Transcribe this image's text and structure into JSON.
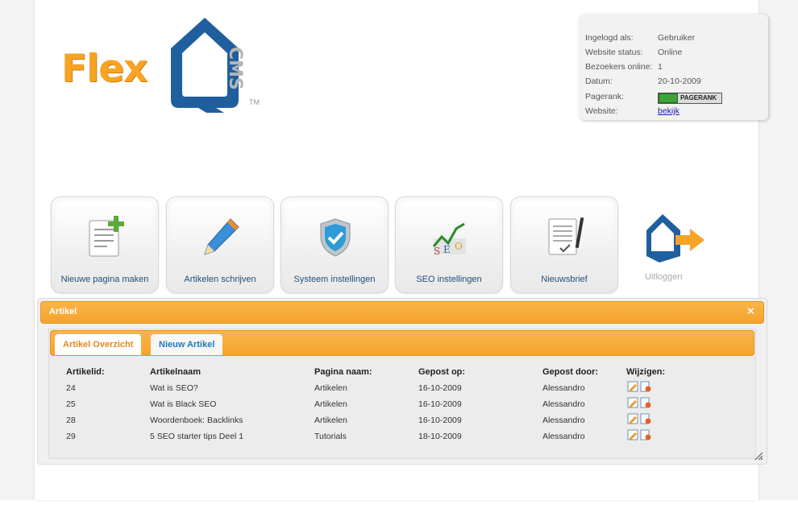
{
  "logo": {
    "brand": "Flex",
    "suffix": "CMS",
    "tm": "TM"
  },
  "info": {
    "rows": [
      {
        "label": "Ingelogd als:",
        "value": "Gebruiker"
      },
      {
        "label": "Website status:",
        "value": "Online"
      },
      {
        "label": "Bezoekers online:",
        "value": "1"
      },
      {
        "label": "Datum:",
        "value": "20-10-2009"
      },
      {
        "label": "Pagerank:",
        "value": "PAGERANK"
      },
      {
        "label": "Website:",
        "value": "bekijk"
      }
    ]
  },
  "nav": {
    "items": [
      {
        "label": "Nieuwe pagina maken",
        "icon": "new-page-icon"
      },
      {
        "label": "Artikelen schrijven",
        "icon": "pencil-icon"
      },
      {
        "label": "Systeem instellingen",
        "icon": "shield-check-icon"
      },
      {
        "label": "SEO instellingen",
        "icon": "seo-graph-icon"
      },
      {
        "label": "Nieuwsbrief",
        "icon": "newsletter-icon"
      }
    ],
    "logout": "Uitloggen"
  },
  "panel": {
    "title": "Artikel",
    "close": "×",
    "tabs": [
      {
        "label": "Artikel Overzicht",
        "active": true
      },
      {
        "label": "Nieuw Artikel",
        "active": false
      }
    ],
    "columns": [
      "Artikelid:",
      "Artikelnaam",
      "Pagina naam:",
      "Gepost op:",
      "Gepost door:",
      "Wijzigen:"
    ],
    "rows": [
      {
        "id": "24",
        "name": "Wat is SEO?",
        "page": "Artikelen",
        "date": "16-10-2009",
        "author": "Alessandro"
      },
      {
        "id": "25",
        "name": "Wat is Black SEO",
        "page": "Artikelen",
        "date": "16-10-2009",
        "author": "Alessandro"
      },
      {
        "id": "28",
        "name": "Woordenboek: Backlinks",
        "page": "Artikelen",
        "date": "16-10-2009",
        "author": "Alessandro"
      },
      {
        "id": "29",
        "name": "5 SEO starter tips Deel 1",
        "page": "Tutorials",
        "date": "18-10-2009",
        "author": "Alessandro"
      }
    ]
  },
  "colors": {
    "orange": "#f5a32c",
    "blue": "#1f5f9e",
    "link": "#1a1aa6"
  }
}
